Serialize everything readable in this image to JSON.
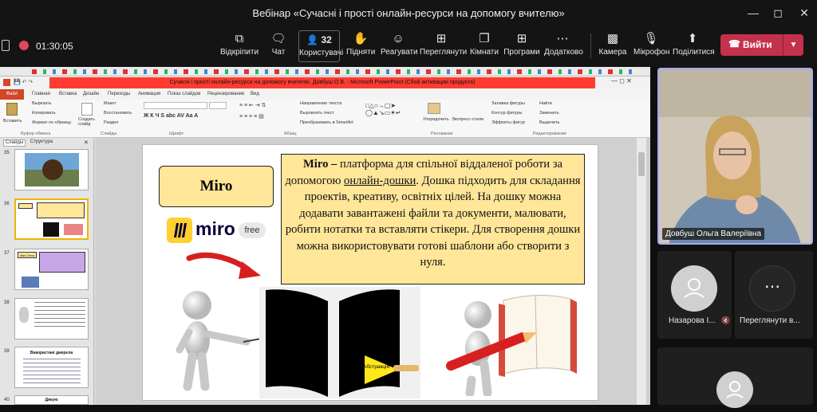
{
  "window": {
    "title": "Вебінар «Сучасні і прості онлайн-ресурси на допомогу вчителю»"
  },
  "meeting": {
    "timer": "01:30:05",
    "people_count": "32",
    "buttons": [
      {
        "label": "Відкріпити",
        "icon": "unpin-icon"
      },
      {
        "label": "Чат",
        "icon": "chat-icon"
      },
      {
        "label": "Користувачі",
        "icon": "people-icon"
      },
      {
        "label": "Підняти",
        "icon": "raise-hand-icon"
      },
      {
        "label": "Реагувати",
        "icon": "react-icon"
      },
      {
        "label": "Переглянути",
        "icon": "view-icon"
      },
      {
        "label": "Кімнати",
        "icon": "rooms-icon"
      },
      {
        "label": "Програми",
        "icon": "apps-icon"
      },
      {
        "label": "Додатково",
        "icon": "more-icon"
      },
      {
        "label": "Камера",
        "icon": "camera-off-icon"
      },
      {
        "label": "Мікрофон",
        "icon": "mic-off-icon"
      },
      {
        "label": "Поділитися",
        "icon": "share-icon"
      }
    ],
    "leave_label": "Вийти",
    "accent": "#c4314b"
  },
  "ppt": {
    "title": "Сучасні і прості онлайн-ресурси на допомогу вчителю. Довбуш О.В. - Microsoft PowerPoint (Сбой активации продукта)",
    "tabs": [
      "Файл",
      "Главная",
      "Вставка",
      "Дизайн",
      "Переходы",
      "Анимация",
      "Показ слайдов",
      "Рецензирование",
      "Вид"
    ],
    "ribbon": {
      "paste": "Вставить",
      "cut": "Вырезать",
      "copy": "Копировать",
      "format_painter": "Формат по образцу",
      "clipboard": "Буфер обмена",
      "new_slide": "Создать слайд",
      "layout": "Макет",
      "reset": "Восстановить",
      "section": "Раздел",
      "slides": "Слайды",
      "font": "Шрифт",
      "paragraph": "Абзац",
      "text_direction": "Направление текста",
      "align_text": "Выровнять текст",
      "smartart": "Преобразовать в SmartArt",
      "arrange": "Упорядочить",
      "quick_styles": "Экспресс-стили",
      "shape_fill": "Заливка фигуры",
      "shape_outline": "Контур фигуры",
      "shape_effects": "Эффекты фигур",
      "drawing": "Рисование",
      "find": "Найти",
      "replace": "Заменить",
      "select": "Выделить",
      "editing": "Редактирование"
    },
    "panel_tabs": [
      "Слайды",
      "Структура"
    ],
    "thumb_numbers": [
      "35",
      "36",
      "37",
      "38",
      "39",
      "40"
    ],
    "thumb_texts": {
      "t37_title": "Вікі Стіна",
      "t39_title": "Використані джерела",
      "t40_title": "Дякую"
    }
  },
  "slide": {
    "title": "Miro",
    "text_bold": "Miro –",
    "text_before_link": " платформа для спільної віддаленої роботи за допомогою ",
    "text_link": "онлайн-дошки",
    "text_after_link": ". Дошка підходить для складання проектів, креативу, освітніх цілей. На дошку можна додавати завантажені файли та документи, малювати, робити нотатки та вставляти стікери. Для створення дошки можна використовувати готові шаблони або створити з нуля.",
    "logo_text": "miro",
    "logo_badge": "free",
    "torch_label": "Абстракція"
  },
  "participants": {
    "self_name": "Довбуш Ольга Валеріївна",
    "other_name": "Назарова І...",
    "more_label": "Переглянути в..."
  }
}
